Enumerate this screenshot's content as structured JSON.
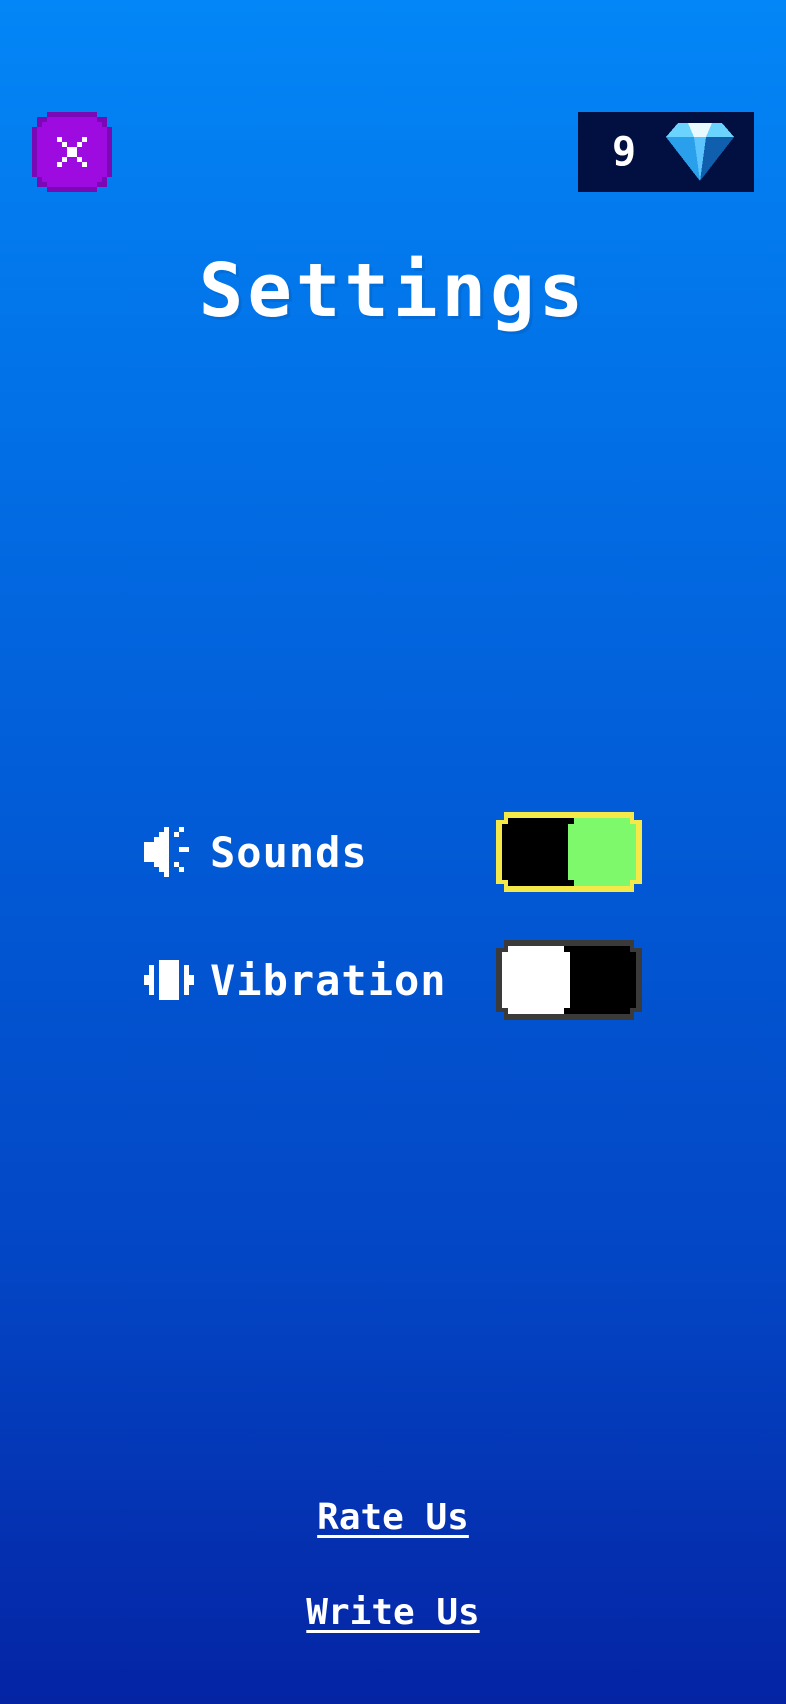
{
  "header": {
    "close_icon": "close-x-icon",
    "gem_count": "9",
    "gem_icon": "diamond-icon"
  },
  "title": "Settings",
  "settings": [
    {
      "icon": "speaker-icon",
      "label": "Sounds",
      "enabled": true
    },
    {
      "icon": "vibration-icon",
      "label": "Vibration",
      "enabled": false
    }
  ],
  "links": {
    "rate": "Rate Us",
    "write": "Write Us"
  },
  "colors": {
    "close_button": "#9d0be0",
    "gem_panel": "#011040",
    "toggle_on_fill": "#7ef96c",
    "toggle_on_border": "#f5e94a",
    "toggle_off_border": "#3a3a3a"
  }
}
